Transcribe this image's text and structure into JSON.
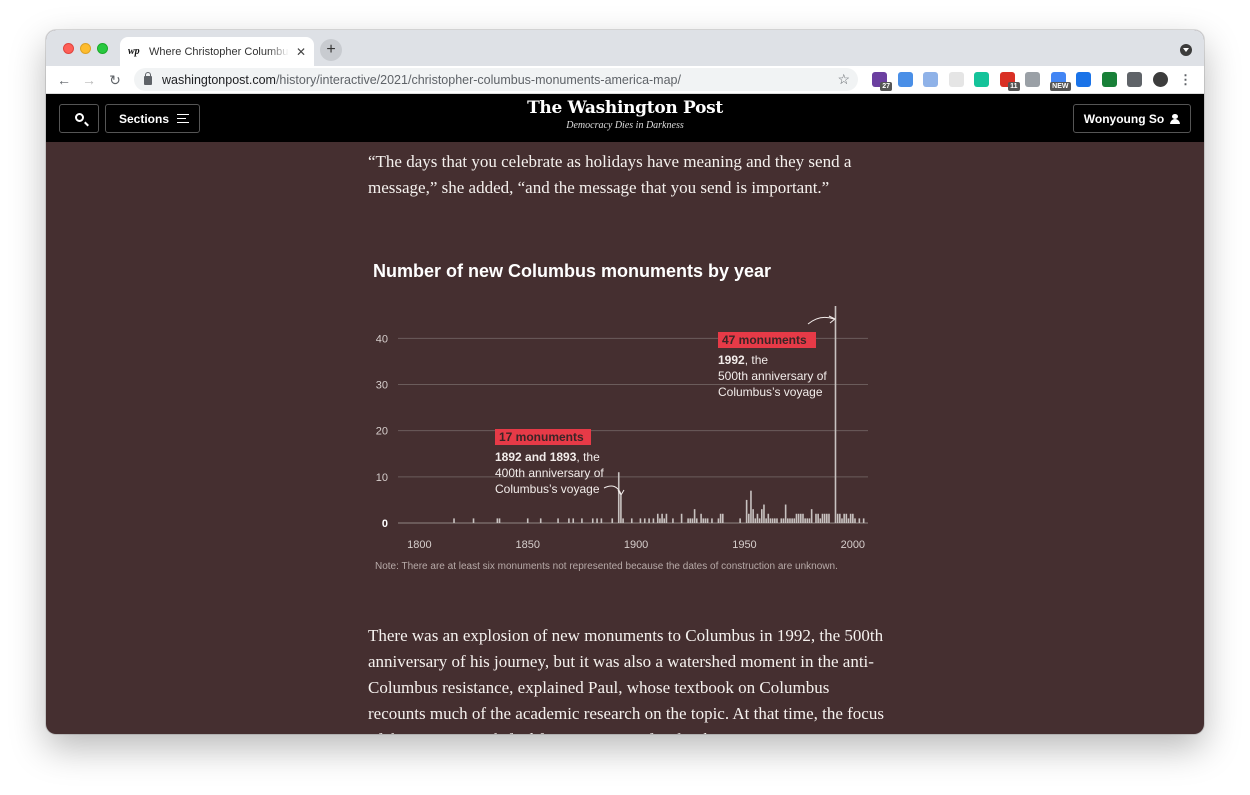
{
  "browser": {
    "tab_title": "Where Christopher Columbus monuments stand in America",
    "tab_favicon": "wp",
    "tab_close": "✕",
    "new_tab": "+",
    "url_host": "washingtonpost.com",
    "url_path": "/history/interactive/2021/christopher-columbus-monuments-america-map/",
    "extensions": [
      {
        "name": "extension-icon",
        "color": "#6b3fa0",
        "badge": "27"
      },
      {
        "name": "extension-icon",
        "color": "#4a8fe7",
        "badge": ""
      },
      {
        "name": "extension-icon",
        "color": "#8fb2e8",
        "badge": ""
      },
      {
        "name": "extension-icon",
        "color": "#e5e5e5",
        "badge": ""
      },
      {
        "name": "grammarly-icon",
        "color": "#15c39a",
        "badge": ""
      },
      {
        "name": "extension-icon",
        "color": "#d93025",
        "badge": "11"
      },
      {
        "name": "camera-icon",
        "color": "#9aa0a6",
        "badge": ""
      },
      {
        "name": "extension-icon",
        "color": "#4285f4",
        "badge": "NEW"
      },
      {
        "name": "infinity-icon",
        "color": "#1a73e8",
        "badge": ""
      },
      {
        "name": "heart-icon",
        "color": "#188038",
        "badge": ""
      },
      {
        "name": "puzzle-icon",
        "color": "#5f6368",
        "badge": ""
      },
      {
        "name": "profile-avatar-icon",
        "color": "#3c3c3c",
        "badge": ""
      },
      {
        "name": "kebab-menu-icon",
        "color": "#5f6368",
        "badge": ""
      }
    ]
  },
  "header": {
    "sections_label": "Sections",
    "masthead": "The Washington Post",
    "tagline": "Democracy Dies in Darkness",
    "user_label": "Wonyoung So"
  },
  "article": {
    "para_top": "“The days that you celebrate as holidays have meaning and they send a message,” she added, “and the message that you send is important.”",
    "para_bottom": "There was an explosion of new monuments to Columbus in 1992, the 500th anniversary of his journey, but it was also a watershed moment in the anti-Columbus resistance, explained Paul, whose textbook on Columbus recounts much of the academic research on the topic. At that time, the focus of the movement shifted from criticism of Columbus to"
  },
  "chart_data": {
    "type": "bar",
    "title": "Number of new Columbus monuments by year",
    "xlabel": "",
    "ylabel": "",
    "xlim": [
      1792,
      2007
    ],
    "ylim": [
      0,
      47
    ],
    "x_ticks": [
      1800,
      1850,
      1900,
      1950,
      2000
    ],
    "y_ticks": [
      0,
      10,
      20,
      30,
      40
    ],
    "grid": true,
    "bar_color": "#c8c2c0",
    "highlight_color": "#e63a47",
    "series": [
      {
        "name": "",
        "points": [
          [
            1816,
            1
          ],
          [
            1825,
            1
          ],
          [
            1836,
            1
          ],
          [
            1837,
            1
          ],
          [
            1850,
            1
          ],
          [
            1856,
            1
          ],
          [
            1864,
            1
          ],
          [
            1869,
            1
          ],
          [
            1871,
            1
          ],
          [
            1875,
            1
          ],
          [
            1880,
            1
          ],
          [
            1882,
            1
          ],
          [
            1884,
            1
          ],
          [
            1889,
            1
          ],
          [
            1892,
            11
          ],
          [
            1893,
            6
          ],
          [
            1894,
            1
          ],
          [
            1898,
            1
          ],
          [
            1902,
            1
          ],
          [
            1904,
            1
          ],
          [
            1906,
            1
          ],
          [
            1908,
            1
          ],
          [
            1910,
            2
          ],
          [
            1911,
            1
          ],
          [
            1912,
            2
          ],
          [
            1913,
            1
          ],
          [
            1914,
            2
          ],
          [
            1917,
            1
          ],
          [
            1921,
            2
          ],
          [
            1924,
            1
          ],
          [
            1925,
            1
          ],
          [
            1926,
            1
          ],
          [
            1927,
            3
          ],
          [
            1928,
            1
          ],
          [
            1930,
            2
          ],
          [
            1931,
            1
          ],
          [
            1932,
            1
          ],
          [
            1933,
            1
          ],
          [
            1935,
            1
          ],
          [
            1938,
            1
          ],
          [
            1939,
            2
          ],
          [
            1940,
            2
          ],
          [
            1948,
            1
          ],
          [
            1951,
            5
          ],
          [
            1952,
            2
          ],
          [
            1953,
            7
          ],
          [
            1954,
            3
          ],
          [
            1955,
            1
          ],
          [
            1956,
            2
          ],
          [
            1957,
            1
          ],
          [
            1958,
            3
          ],
          [
            1959,
            4
          ],
          [
            1960,
            1
          ],
          [
            1961,
            2
          ],
          [
            1962,
            1
          ],
          [
            1963,
            1
          ],
          [
            1964,
            1
          ],
          [
            1965,
            1
          ],
          [
            1967,
            1
          ],
          [
            1968,
            1
          ],
          [
            1969,
            4
          ],
          [
            1970,
            1
          ],
          [
            1971,
            1
          ],
          [
            1972,
            1
          ],
          [
            1973,
            1
          ],
          [
            1974,
            2
          ],
          [
            1975,
            2
          ],
          [
            1976,
            2
          ],
          [
            1977,
            2
          ],
          [
            1978,
            1
          ],
          [
            1979,
            1
          ],
          [
            1980,
            1
          ],
          [
            1981,
            3
          ],
          [
            1983,
            2
          ],
          [
            1984,
            2
          ],
          [
            1985,
            1
          ],
          [
            1986,
            2
          ],
          [
            1987,
            2
          ],
          [
            1988,
            2
          ],
          [
            1989,
            2
          ],
          [
            1992,
            47
          ],
          [
            1993,
            2
          ],
          [
            1994,
            2
          ],
          [
            1995,
            1
          ],
          [
            1996,
            2
          ],
          [
            1997,
            2
          ],
          [
            1998,
            1
          ],
          [
            1999,
            2
          ],
          [
            2000,
            2
          ],
          [
            2001,
            1
          ],
          [
            2003,
            1
          ],
          [
            2005,
            1
          ]
        ]
      }
    ],
    "annotations": [
      {
        "label": "17 monuments",
        "bold": "1892 and 1893",
        "text": ", the 400th anniversary of Columbus’s voyage"
      },
      {
        "label": "47 monuments",
        "bold": "1992",
        "text": ", the 500th anniversary of Columbus’s voyage"
      }
    ],
    "note": "Note: There are at least six monuments not represented because the dates of construction are unknown."
  }
}
